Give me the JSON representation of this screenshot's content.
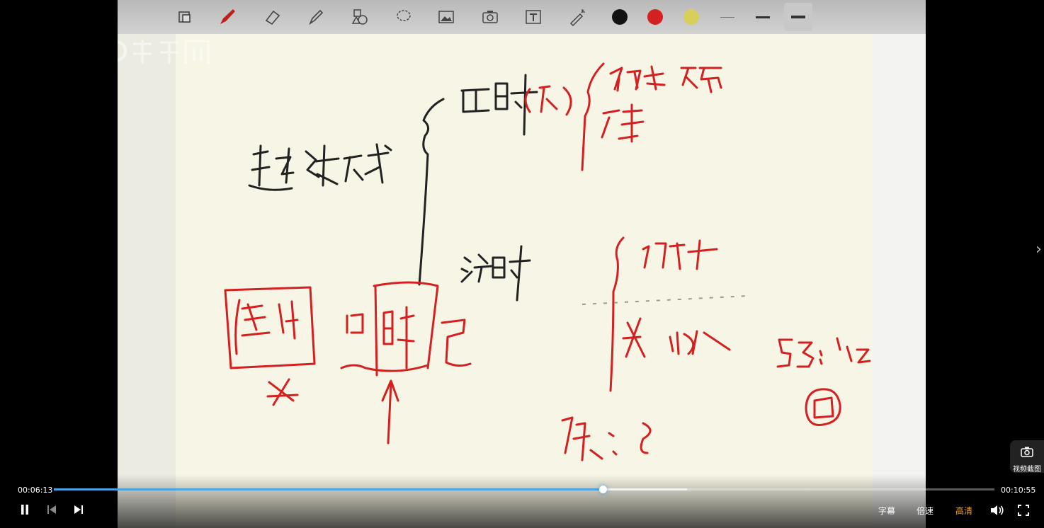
{
  "player": {
    "current_time": "00:06:13",
    "total_time": "00:10:55",
    "progress": 0.5836,
    "buffered": 0.673,
    "subtitle_label": "字幕",
    "speed_label": "倍速",
    "quality_label": "高清",
    "screenshot_label": "视频截图",
    "accent_color": "#4aa3df",
    "quality_color": "#f5a623"
  },
  "toolbar": {
    "tools": [
      "select-icon",
      "pen-icon",
      "eraser-icon",
      "highlighter-icon",
      "shapes-icon",
      "lasso-icon",
      "image-icon",
      "camera-icon",
      "text-icon",
      "laser-icon"
    ],
    "colors": [
      "#111111",
      "#d42020",
      "#d8cf5a"
    ],
    "line_widths": [
      "thin",
      "medium",
      "thick"
    ]
  }
}
